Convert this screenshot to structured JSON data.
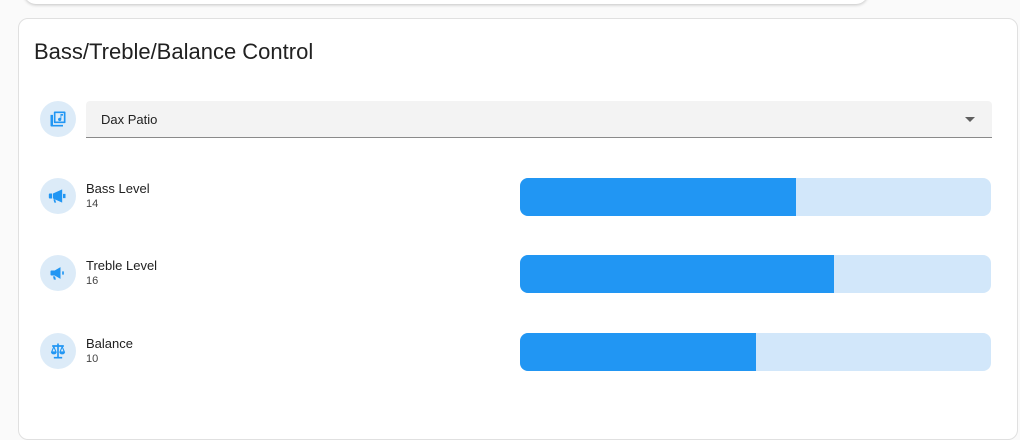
{
  "card": {
    "title": "Bass/Treble/Balance Control"
  },
  "source_select": {
    "value": "Dax Patio",
    "icon": "speaker-group-icon"
  },
  "controls": [
    {
      "label": "Bass Level",
      "value": "14",
      "fill_percent": 58.5,
      "icon": "bullhorn-icon"
    },
    {
      "label": "Treble Level",
      "value": "16",
      "fill_percent": 66.7,
      "icon": "megaphone-icon"
    },
    {
      "label": "Balance",
      "value": "10",
      "fill_percent": 50,
      "icon": "scale-balance-icon"
    }
  ],
  "colors": {
    "accent": "#2196f3",
    "accent_light": "#d2e7fa",
    "icon_bg": "#dcebf8"
  }
}
